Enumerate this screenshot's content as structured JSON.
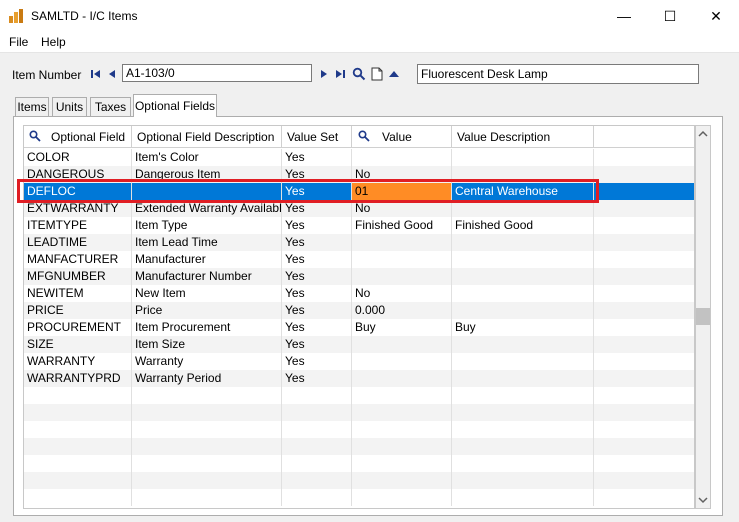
{
  "window": {
    "title": "SAMLTD - I/C Items",
    "minimize_glyph": "—",
    "maximize_glyph": "☐",
    "close_glyph": "✕"
  },
  "menu": {
    "items": [
      "File",
      "Help"
    ]
  },
  "item_row": {
    "label": "Item Number",
    "item_number": "A1-103/0",
    "description": "Fluorescent Desk Lamp"
  },
  "tabs": [
    {
      "label": "Items",
      "active": false
    },
    {
      "label": "Units",
      "active": false
    },
    {
      "label": "Taxes",
      "active": false
    },
    {
      "label": "Optional Fields",
      "active": true
    }
  ],
  "grid": {
    "columns": [
      "Optional Field",
      "Optional Field Description",
      "Value Set",
      "Value",
      "Value Description"
    ],
    "rows": [
      [
        "COLOR",
        "Item's Color",
        "Yes",
        "",
        ""
      ],
      [
        "DANGEROUS",
        "Dangerous Item",
        "Yes",
        "No",
        ""
      ],
      [
        "DEFLOC",
        "",
        "Yes",
        "01",
        "Central Warehouse"
      ],
      [
        "EXTWARRANTY",
        "Extended Warranty Available",
        "Yes",
        "No",
        ""
      ],
      [
        "ITEMTYPE",
        "Item Type",
        "Yes",
        "Finished Good",
        "Finished Good"
      ],
      [
        "LEADTIME",
        "Item Lead Time",
        "Yes",
        "",
        ""
      ],
      [
        "MANFACTURER",
        "Manufacturer",
        "Yes",
        "",
        ""
      ],
      [
        "MFGNUMBER",
        "Manufacturer Number",
        "Yes",
        "",
        ""
      ],
      [
        "NEWITEM",
        "New Item",
        "Yes",
        "No",
        ""
      ],
      [
        "PRICE",
        "Price",
        "Yes",
        "0.000",
        ""
      ],
      [
        "PROCUREMENT",
        "Item Procurement",
        "Yes",
        "Buy",
        "Buy"
      ],
      [
        "SIZE",
        "Item Size",
        "Yes",
        "",
        ""
      ],
      [
        "WARRANTY",
        "Warranty",
        "Yes",
        "",
        ""
      ],
      [
        "WARRANTYPRD",
        "Warranty Period",
        "Yes",
        "",
        ""
      ]
    ],
    "selected_row": 2,
    "empty_rows": 7
  },
  "colors": {
    "selection": "#0078d7",
    "value_cell_highlight": "#ff8c25",
    "callout_border": "#e01e24"
  },
  "icons": [
    "app-icon",
    "first-record-icon",
    "previous-record-icon",
    "next-record-icon",
    "last-record-icon",
    "finder-icon",
    "new-document-icon",
    "zoom-up-icon",
    "column-finder-icon"
  ]
}
